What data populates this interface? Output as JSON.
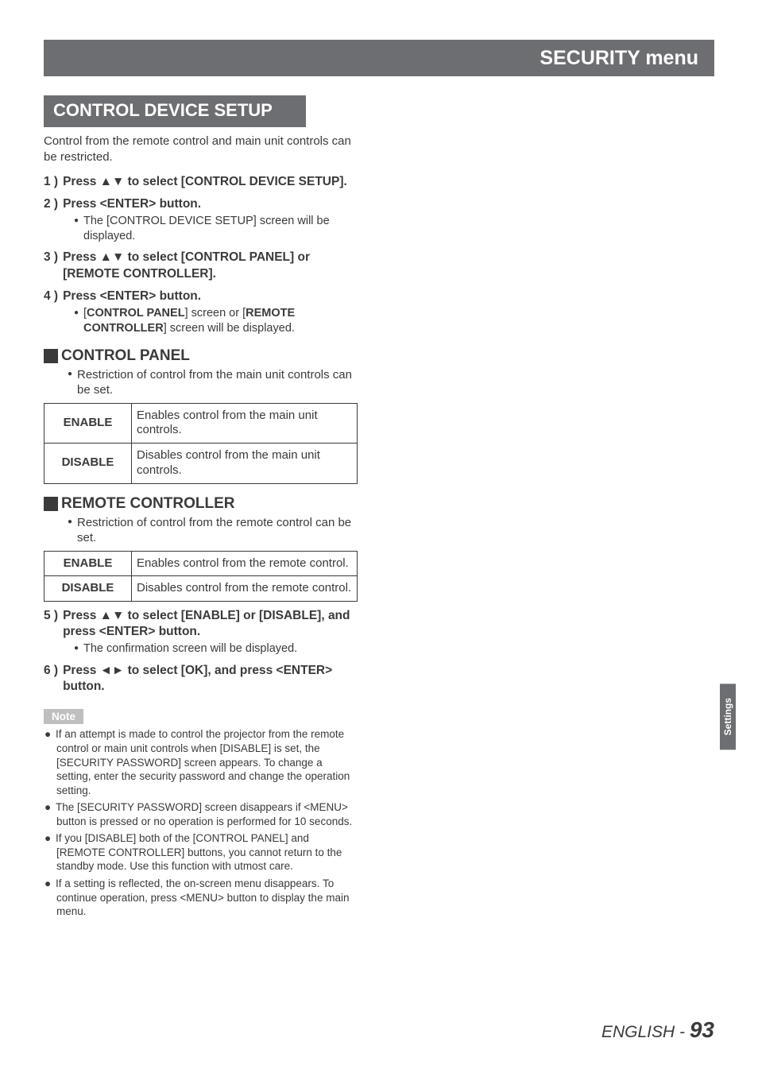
{
  "header": {
    "title": "SECURITY menu"
  },
  "section": {
    "title": "CONTROL DEVICE SETUP"
  },
  "intro": "Control from the remote control and main unit controls can be restricted.",
  "steps": {
    "s1": {
      "num": "1 )",
      "text": "Press ▲▼ to select [CONTROL DEVICE SETUP]."
    },
    "s2": {
      "num": "2 )",
      "text": "Press <ENTER> button.",
      "sub": "The [CONTROL DEVICE SETUP] screen will be displayed."
    },
    "s3": {
      "num": "3 )",
      "text": "Press ▲▼ to select [CONTROL PANEL] or [REMOTE CONTROLLER]."
    },
    "s4": {
      "num": "4 )",
      "text": "Press <ENTER> button.",
      "sub_pre": "[",
      "sub_b1": "CONTROL PANEL",
      "sub_mid": "] screen or [",
      "sub_b2": "REMOTE CONTROLLER",
      "sub_post": "] screen will be displayed."
    },
    "s5": {
      "num": "5 )",
      "text": "Press ▲▼ to select [ENABLE] or [DISABLE], and press <ENTER> button.",
      "sub": "The confirmation screen will be displayed."
    },
    "s6": {
      "num": "6 )",
      "text": "Press ◄► to select [OK], and press <ENTER> button."
    }
  },
  "sub_cp": {
    "title": "CONTROL PANEL",
    "bullet": "Restriction of control from the main unit controls can be set.",
    "rows": [
      {
        "k": "ENABLE",
        "v": "Enables control from the main unit controls."
      },
      {
        "k": "DISABLE",
        "v": "Disables control from the main unit controls."
      }
    ]
  },
  "sub_rc": {
    "title": "REMOTE CONTROLLER",
    "bullet": "Restriction of control from the remote control can be set.",
    "rows": [
      {
        "k": "ENABLE",
        "v": "Enables control from the remote control."
      },
      {
        "k": "DISABLE",
        "v": "Disables control from the remote control."
      }
    ]
  },
  "note": {
    "label": "Note",
    "items": [
      "If an attempt is made to control the projector from the remote control or main unit controls when [DISABLE] is set, the [SECURITY PASSWORD] screen appears. To change a setting, enter the security password and change the operation setting.",
      "The [SECURITY PASSWORD] screen disappears if <MENU> button is pressed or no operation is performed for 10 seconds.",
      "If you [DISABLE] both of the [CONTROL PANEL] and [REMOTE CONTROLLER] buttons, you cannot return to the standby mode. Use this function with utmost care.",
      "If a setting is reflected, the on-screen menu disappears. To continue operation, press <MENU> button to display the main menu."
    ]
  },
  "sidetab": "Settings",
  "footer": {
    "lang": "ENGLISH - ",
    "page": "93"
  }
}
